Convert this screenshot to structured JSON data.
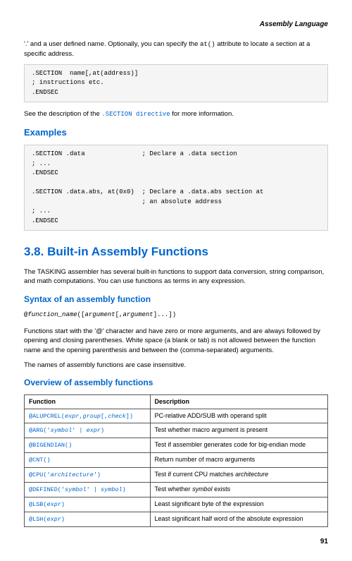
{
  "header": {
    "title": "Assembly Language"
  },
  "intro_line": "'.' and a user defined name. Optionally, you can specify the ",
  "intro_code": "at()",
  "intro_line2": " attribute to locate a section at a specific address.",
  "codebox1": ".SECTION  name[,at(address)]\n; instructions etc.\n.ENDSEC",
  "see_prefix": "See the description of the ",
  "see_link": ".SECTION directive",
  "see_suffix": " for more information.",
  "examples_heading": "Examples",
  "codebox2": ".SECTION .data               ; Declare a .data section\n; ...\n.ENDSEC\n\n.SECTION .data.abs, at(0x0)  ; Declare a .data.abs section at\n                             ; an absolute address\n; ...\n.ENDSEC",
  "section_heading": "3.8. Built-in Assembly Functions",
  "section_para": "The TASKING assembler has several built-in functions to support data conversion, string comparison, and math computations. You can use functions as terms in any expression.",
  "syntax_heading": "Syntax of an assembly function",
  "syntax_code_prefix": "@",
  "syntax_code_name": "function_name",
  "syntax_code_open": "([",
  "syntax_code_arg1": "argument",
  "syntax_code_mid": "[,",
  "syntax_code_arg2": "argument",
  "syntax_code_close": "]...])",
  "syntax_para1": "Functions start with the '@' character and have zero or more arguments, and are always followed by opening and closing parentheses. White space (a blank or tab) is not allowed between the function name and the opening parenthesis and between the (comma-separated) arguments.",
  "syntax_para2": "The names of assembly functions are case insensitive.",
  "overview_heading": "Overview of assembly functions",
  "table": {
    "h1": "Function",
    "h2": "Description",
    "rows": [
      {
        "fn_parts": [
          "@ALUPCREL(",
          "expr",
          ",",
          "group",
          "[,",
          "check",
          "])"
        ],
        "desc_parts": [
          "PC-relative ADD/SUB with operand split"
        ]
      },
      {
        "fn_parts": [
          "@ARG('",
          "symbol",
          "' | ",
          "expr",
          ")"
        ],
        "desc_parts": [
          "Test whether macro argument is present"
        ]
      },
      {
        "fn_parts": [
          "@BIGENDIAN()"
        ],
        "desc_parts": [
          "Test if assembler generates code for big-endian mode"
        ]
      },
      {
        "fn_parts": [
          "@CNT()"
        ],
        "desc_parts": [
          "Return number of macro arguments"
        ]
      },
      {
        "fn_parts": [
          "@CPU('",
          "architecture",
          "')"
        ],
        "desc_parts": [
          "Test if current CPU matches ",
          "architecture"
        ]
      },
      {
        "fn_parts": [
          "@DEFINED('",
          "symbol",
          "' | ",
          "symbol",
          ")"
        ],
        "desc_parts": [
          "Test whether ",
          "symbol",
          " exists"
        ]
      },
      {
        "fn_parts": [
          "@LSB(",
          "expr",
          ")"
        ],
        "desc_parts": [
          "Least significant byte of the expression"
        ]
      },
      {
        "fn_parts": [
          "@LSH(",
          "expr",
          ")"
        ],
        "desc_parts": [
          "Least significant half word of the absolute expression"
        ]
      }
    ]
  },
  "page_number": "91"
}
